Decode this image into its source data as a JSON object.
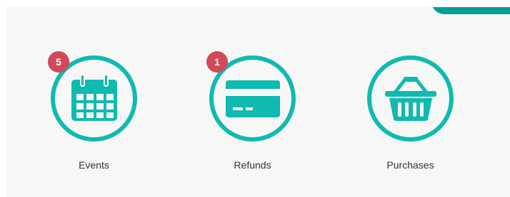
{
  "colors": {
    "accent": "#0fbab0",
    "badge": "#d24a59",
    "corner_tab": "#009f95",
    "panel_bg": "#f7f7f7"
  },
  "tiles": [
    {
      "label": "Events",
      "badge": "5",
      "icon": "calendar-icon"
    },
    {
      "label": "Refunds",
      "badge": "1",
      "icon": "credit-card-icon"
    },
    {
      "label": "Purchases",
      "badge": null,
      "icon": "shopping-basket-icon"
    }
  ]
}
